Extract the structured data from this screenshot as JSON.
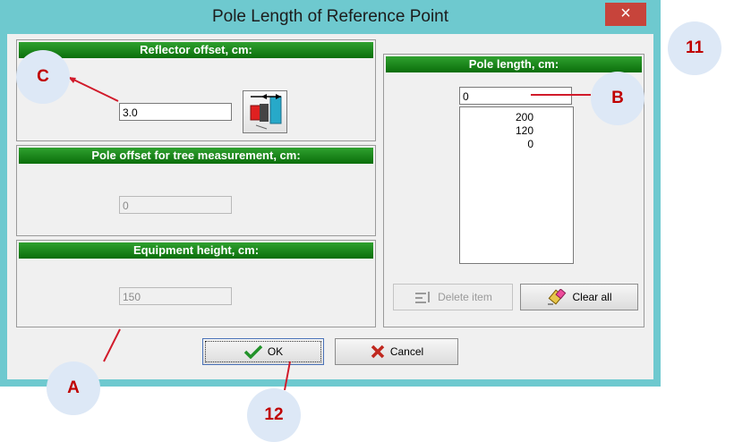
{
  "dialog": {
    "title": "Pole Length of Reference Point",
    "close_symbol": "×"
  },
  "reflector": {
    "header": "Reflector offset, cm:",
    "value": "3.0",
    "icon": "reflector-offset-icon"
  },
  "pole_offset": {
    "header": "Pole offset for tree measurement, cm:",
    "value": "0"
  },
  "equipment": {
    "header": "Equipment height, cm:",
    "value": "150"
  },
  "pole_length": {
    "header": "Pole length, cm:",
    "value": "0",
    "items": [
      "200",
      "120",
      "0"
    ],
    "delete_label": "Delete item",
    "clear_label": "Clear all"
  },
  "footer": {
    "ok_label": "OK",
    "cancel_label": "Cancel"
  },
  "annotations": {
    "a": "A",
    "b": "B",
    "c": "C",
    "n11": "11",
    "n12": "12",
    "color": "#c00000"
  }
}
